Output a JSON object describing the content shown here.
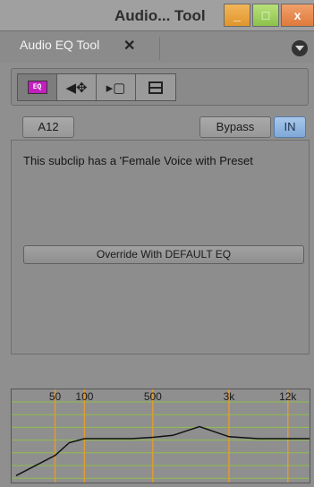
{
  "window": {
    "title": "Audio... Tool",
    "minimize_label": "_",
    "maximize_label": "□",
    "close_label": "x"
  },
  "tab": {
    "label": "Audio EQ Tool",
    "close_label": "✕"
  },
  "toolbar": {
    "eq_icon_text": "EQ",
    "items": [
      "eq-icon",
      "speaker-arrows-icon",
      "frame-icon",
      "horizontal-split-icon"
    ]
  },
  "controls": {
    "track_label": "A12",
    "bypass_label": "Bypass",
    "in_label": "IN"
  },
  "panel": {
    "info_text": "This subclip has a 'Female Voice with Preset",
    "override_label": "Override With DEFAULT EQ"
  },
  "eq_graph": {
    "frequency_labels": [
      "50",
      "100",
      "500",
      "3k",
      "12k"
    ],
    "curve": [
      {
        "hz": 20,
        "db": -5.5
      },
      {
        "hz": 50,
        "db": -2.5
      },
      {
        "hz": 70,
        "db": -0.6
      },
      {
        "hz": 100,
        "db": 0
      },
      {
        "hz": 300,
        "db": 0
      },
      {
        "hz": 500,
        "db": 0.2
      },
      {
        "hz": 800,
        "db": 0.5
      },
      {
        "hz": 1500,
        "db": 1.8
      },
      {
        "hz": 3000,
        "db": 0.3
      },
      {
        "hz": 6000,
        "db": 0
      },
      {
        "hz": 20000,
        "db": 0
      }
    ],
    "colors": {
      "grid": "#8fbf4a",
      "freq_lines": "#e39a2f",
      "curve": "#111111",
      "label": "#1b1b1b"
    }
  }
}
